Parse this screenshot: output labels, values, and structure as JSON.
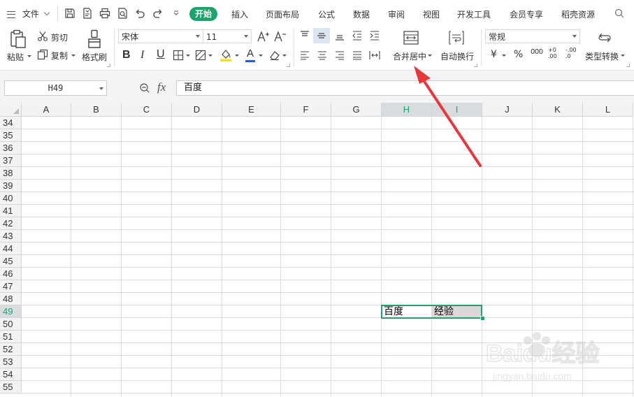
{
  "menubar": {
    "file_label": "文件",
    "tabs": [
      "开始",
      "插入",
      "页面布局",
      "公式",
      "数据",
      "审阅",
      "视图",
      "开发工具",
      "会员专享",
      "稻壳资源"
    ],
    "active_tab": "开始",
    "search_icon": "search-icon",
    "accent_color": "#1aa36a"
  },
  "ribbon": {
    "paste_label": "粘贴",
    "cut_label": "剪切",
    "copy_label": "复制",
    "format_painter_label": "格式刷",
    "font_name": "宋体",
    "font_size": "11",
    "bold_label": "B",
    "italic_label": "I",
    "underline_label": "U",
    "font_color_label": "A",
    "merge_center_label": "合并居中",
    "wrap_text_label": "自动换行",
    "number_format": "常规",
    "currency_label": "¥",
    "percent_label": "%",
    "thousands_label": "000",
    "inc_decimal_label": "+0 .00",
    "dec_decimal_label": "-.00 .0",
    "type_convert_label": "类型转换"
  },
  "formula_bar": {
    "name_box": "H49",
    "fx_label": "fx",
    "content": "百度"
  },
  "sheet": {
    "columns": [
      "A",
      "B",
      "C",
      "D",
      "E",
      "F",
      "G",
      "H",
      "I",
      "J",
      "K",
      "L"
    ],
    "selected_columns": [
      "H",
      "I"
    ],
    "rows": [
      "34",
      "35",
      "36",
      "37",
      "38",
      "39",
      "40",
      "41",
      "42",
      "43",
      "44",
      "45",
      "46",
      "47",
      "48",
      "49",
      "50",
      "51",
      "52",
      "53",
      "54",
      "55"
    ],
    "selected_row": "49",
    "cells": {
      "H49": "百度",
      "I49": "经验"
    },
    "selection_color": "#1aa36a"
  },
  "watermark": {
    "brand": "Baidu经验",
    "url": "jingyan.baidu.com"
  }
}
